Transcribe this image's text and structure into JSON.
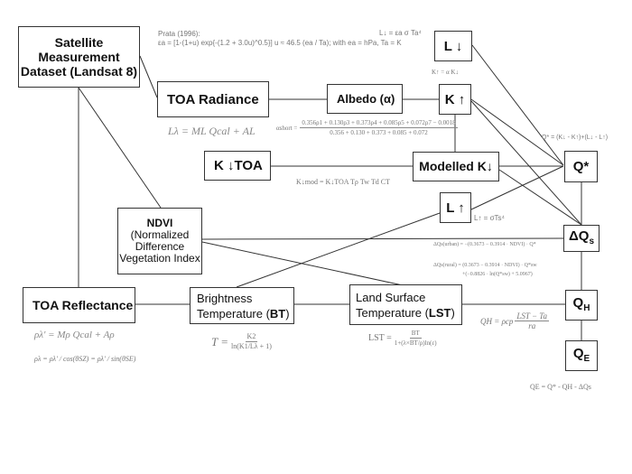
{
  "nodes": {
    "satellite": {
      "line1": "Satellite",
      "line2": "Measurement",
      "line3": "Dataset (Landsat 8)"
    },
    "toa_radiance": {
      "label": "TOA Radiance"
    },
    "albedo": {
      "label": "Albedo (α)"
    },
    "k_up": {
      "label": "K ↑"
    },
    "l_down": {
      "label": "L ↓"
    },
    "k_down_toa": {
      "label": "K ↓TOA"
    },
    "modelled_k_down": {
      "label": "Modelled K↓"
    },
    "q_star": {
      "label": "Q*"
    },
    "l_up": {
      "label": "L ↑"
    },
    "ndvi": {
      "title": "NDVI",
      "line1": "(Normalized",
      "line2": "Difference",
      "line3": "Vegetation Index"
    },
    "delta_qs": {
      "label": "ΔQ",
      "subscript": "s"
    },
    "toa_reflectance": {
      "label": "TOA Reflectance"
    },
    "brightness_temp": {
      "line1": "Brightness",
      "line2_prefix": "Temperature (",
      "line2_bold": "BT",
      "line2_suffix": ")"
    },
    "lst": {
      "line1": "Land Surface",
      "line2_prefix": "Temperature (",
      "line2_bold": "LST",
      "line2_suffix": ")"
    },
    "q_h": {
      "label": "Q",
      "subscript": "H"
    },
    "q_e": {
      "label": "Q",
      "subscript": "E"
    }
  },
  "formulas": {
    "prata_title": "Prata (1996):",
    "prata_eq": "εa = [1-(1+u) exp{-(1.2 + 3.0u)^0.5}]   u ≈ 46.5 (ea / Ta);  with ea = hPa, Ta = K",
    "l_down_eq": "L↓ = εa σ Ta⁴",
    "k_up_eq": "K↑ = α K↓",
    "toa_radiance_eq": "Lλ = ML Qcal + AL",
    "albedo_lhs": "αshort =",
    "albedo_num": "0.356ρ1 + 0.130ρ3 + 0.373ρ4 + 0.085ρ5 + 0.072ρ7 − 0.0018",
    "albedo_den": "0.356 + 0.130 + 0.373 + 0.085 + 0.072",
    "q_star_eq": "Q* = (K↓ - K↑)+(L↓ - L↑)",
    "k_mod_eq": "K↓mod = K↓TOA Tρ Tw Td CT",
    "l_up_eq": "L↑ = σTs⁴",
    "dqs_urban_eq": "ΔQs(urban) = −(0.3673 − 0.3914 · NDVI) · Q*",
    "dqs_rural_eq1": "ΔQs(rural) = (0.3673 − 0.3914 · NDVI) · Q*sw",
    "dqs_rural_eq2": "+(−0.8826 · ln(Q*sw) + 5.0967)",
    "toa_refl_eq1": "ρλ' = Mρ Qcal + Aρ",
    "toa_refl_eq2": "ρλ = ρλ' / cos(θSZ) = ρλ' / sin(θSE)",
    "bt_eq_lhs": "T =",
    "bt_eq_num": "K2",
    "bt_eq_den": "ln(K1/Lλ + 1)",
    "lst_eq_lhs": "LST =",
    "lst_eq_num": "BT",
    "lst_eq_den": "1+(λ×BT/ρ)ln(ε)",
    "qh_eq_lhs": "QH = ρcp",
    "qh_eq_num": "LST − Ta",
    "qh_eq_den": "ra",
    "qe_eq": "QE = Q* - QH - ΔQs"
  }
}
